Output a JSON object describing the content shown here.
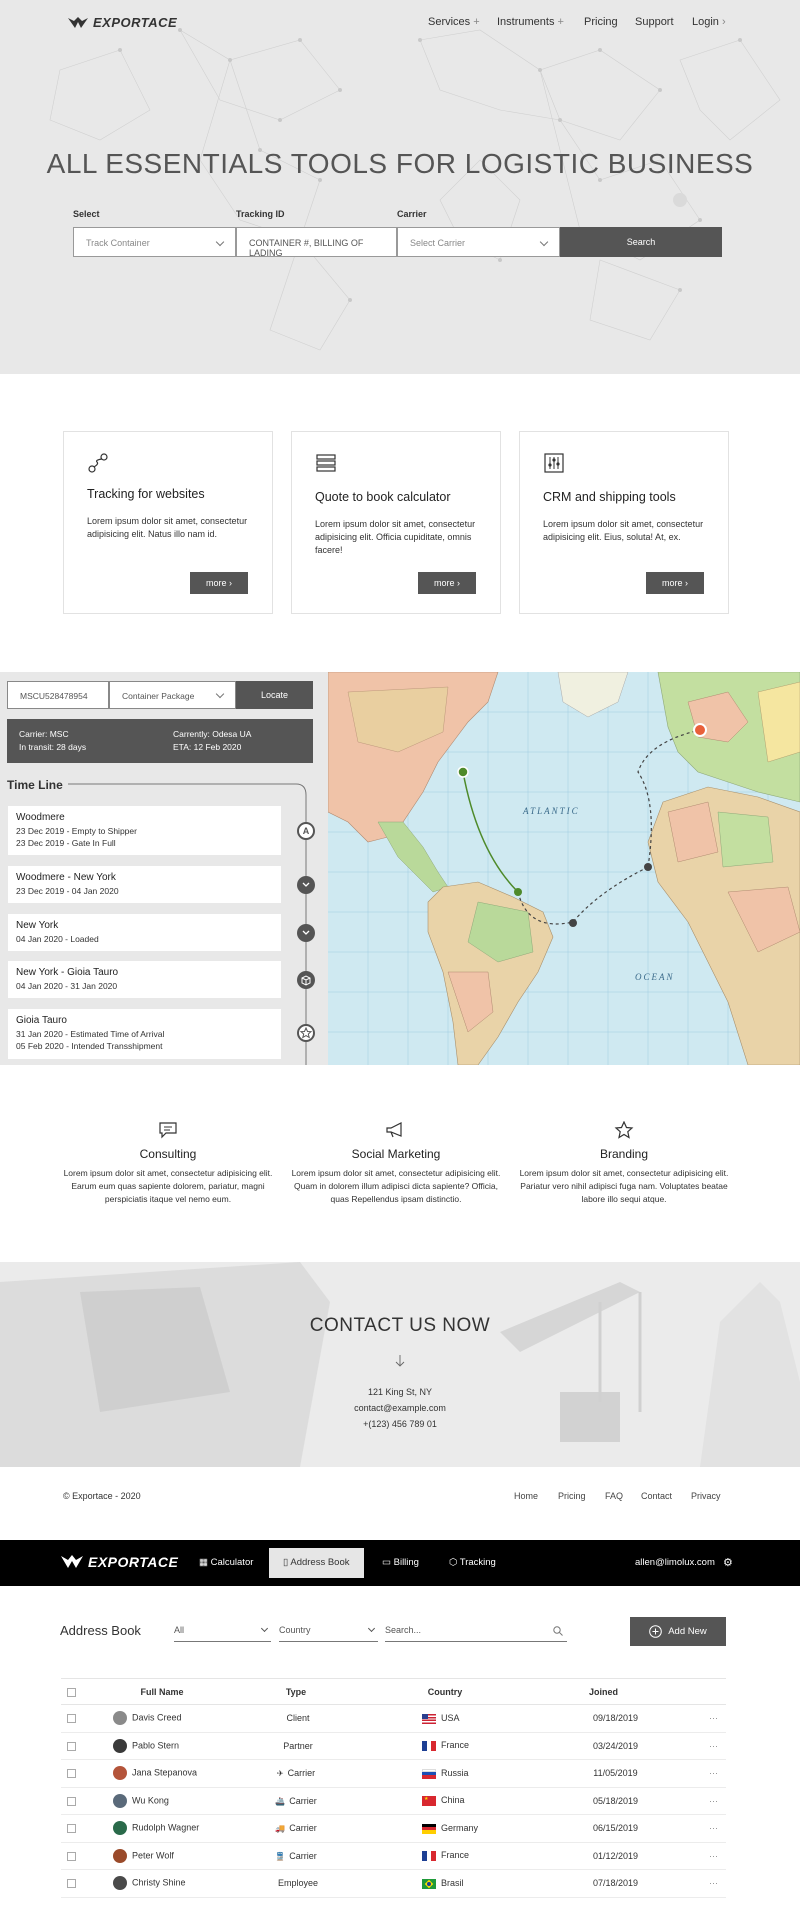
{
  "site": {
    "brand": "EXPORTACE",
    "nav": [
      {
        "label": "Services",
        "suffix": "+"
      },
      {
        "label": "Instruments",
        "suffix": "+"
      },
      {
        "label": "Pricing",
        "suffix": ""
      },
      {
        "label": "Support",
        "suffix": ""
      },
      {
        "label": "Login",
        "suffix": "›"
      }
    ],
    "hero_title": "ALL ESSENTIALS TOOLS FOR LOGISTIC BUSINESS",
    "search": {
      "select_label": "Select",
      "select_value": "Track Container",
      "tracking_label": "Tracking ID",
      "tracking_placeholder": "CONTAINER #, BILLING OF LADING",
      "carrier_label": "Carrier",
      "carrier_value": "Select Carrier",
      "button": "Search"
    }
  },
  "features": [
    {
      "icon": "route-icon",
      "title": "Tracking for websites",
      "desc": "Lorem ipsum dolor sit amet, consectetur adipisicing elit. Natus illo nam id.",
      "button": "more"
    },
    {
      "icon": "list-icon",
      "title": "Quote to book calculator",
      "desc": "Lorem ipsum dolor sit amet, consectetur adipisicing elit. Officia cupiditate, omnis facere!",
      "button": "more"
    },
    {
      "icon": "sliders-icon",
      "title": "CRM and shipping tools",
      "desc": "Lorem ipsum dolor sit amet, consectetur adipisicing elit. Eius, soluta! At, ex.",
      "button": "more"
    }
  ],
  "tracker": {
    "id_value": "MSCU52847895​4",
    "type_value": "Container Package",
    "button": "Locate",
    "info": {
      "carrier": "Carrier: MSC",
      "transit": "In transit: 28 days",
      "currently": "Carrently: Odesa UA",
      "eta": "ETA: 12 Feb 2020"
    },
    "timeline_title": "Time Line",
    "events": [
      {
        "title": "Woodmere",
        "lines": [
          "23 Dec 2019 - Empty to Shipper",
          "23 Dec 2019 - Gate In Full"
        ],
        "icon": "A"
      },
      {
        "title": "Woodmere - New York",
        "lines": [
          "23 Dec 2019 - 04 Jan 2020"
        ],
        "icon": "⌄"
      },
      {
        "title": "New York",
        "lines": [
          "04 Jan 2020 - Loaded"
        ],
        "icon": "⌄"
      },
      {
        "title": "New York - Gioia Tauro",
        "lines": [
          "04 Jan 2020 - 31 Jan 2020"
        ],
        "icon": "box"
      },
      {
        "title": "Gioia Tauro",
        "lines": [
          "31 Jan 2020 - Estimated Time of Arrival",
          "05 Feb 2020 - Intended Transshipment"
        ],
        "icon": "star"
      }
    ],
    "map_labels": {
      "atlantic": "ATLANTIC",
      "ocean": "OCEAN"
    }
  },
  "services": [
    {
      "icon": "chat-icon",
      "title": "Consulting",
      "desc": "Lorem ipsum dolor sit amet, consectetur adipisicing elit. Earum eum quas sapiente dolorem, pariatur, magni perspiciatis itaque vel nemo eum."
    },
    {
      "icon": "megaphone-icon",
      "title": "Social Marketing",
      "desc": "Lorem ipsum dolor sit amet, consectetur adipisicing elit. Quam in dolorem illum adipisci dicta sapiente? Officia, quas Repellendus ipsam distinctio."
    },
    {
      "icon": "star-icon",
      "title": "Branding",
      "desc": "Lorem ipsum dolor sit amet, consectetur adipisicing elit. Pariatur vero nihil adipisci fuga nam. Voluptates beatae labore illo sequi atque."
    }
  ],
  "contact": {
    "title": "CONTACT US NOW",
    "address": "121 King St, NY",
    "email": "contact@example.com",
    "phone": "+(123) 456 789 01"
  },
  "footer": {
    "copyright": "© Exportace - 2020",
    "links": [
      "Home",
      "Pricing",
      "FAQ",
      "Contact",
      "Privacy"
    ]
  },
  "app": {
    "brand": "EXPORTACE",
    "nav": [
      {
        "label": "Calculator",
        "icon": "calculator-icon"
      },
      {
        "label": "Address Book",
        "icon": "book-icon",
        "active": true
      },
      {
        "label": "Billing",
        "icon": "card-icon"
      },
      {
        "label": "Tracking",
        "icon": "package-icon"
      }
    ],
    "user_email": "allen@limolux.com",
    "page_title": "Address Book",
    "filter_type": "All",
    "filter_country": "Country",
    "search_placeholder": "Search...",
    "add_button": "Add New",
    "columns": [
      "Full Name",
      "Type",
      "Country",
      "Joined"
    ],
    "rows": [
      {
        "name": "Davis Creed",
        "type": "Client",
        "type_icon": "",
        "country": "USA",
        "flag": "usa",
        "joined": "09/18/2019",
        "avatar": "#8a8a8a"
      },
      {
        "name": "Pablo Stern",
        "type": "Partner",
        "type_icon": "",
        "country": "France",
        "flag": "france",
        "joined": "03/24/2019",
        "avatar": "#3a3a3a"
      },
      {
        "name": "Jana Stepanova",
        "type": "Carrier",
        "type_icon": "✈",
        "country": "Russia",
        "flag": "russia",
        "joined": "11/05/2019",
        "avatar": "#b4543a"
      },
      {
        "name": "Wu Kong",
        "type": "Carrier",
        "type_icon": "🚢",
        "country": "China",
        "flag": "china",
        "joined": "05/18/2019",
        "avatar": "#5a6a7a"
      },
      {
        "name": "Rudolph Wagner",
        "type": "Carrier",
        "type_icon": "🚚",
        "country": "Germany",
        "flag": "germany",
        "joined": "06/15/2019",
        "avatar": "#2a6a4a"
      },
      {
        "name": "Peter Wolf",
        "type": "Carrier",
        "type_icon": "🚆",
        "country": "France",
        "flag": "france",
        "joined": "01/12/2019",
        "avatar": "#9a4a2a"
      },
      {
        "name": "Christy Shine",
        "type": "Employee",
        "type_icon": "",
        "country": "Brasil",
        "flag": "brasil",
        "joined": "07/18/2019",
        "avatar": "#4a4a4a"
      }
    ],
    "row_menu": "···"
  }
}
